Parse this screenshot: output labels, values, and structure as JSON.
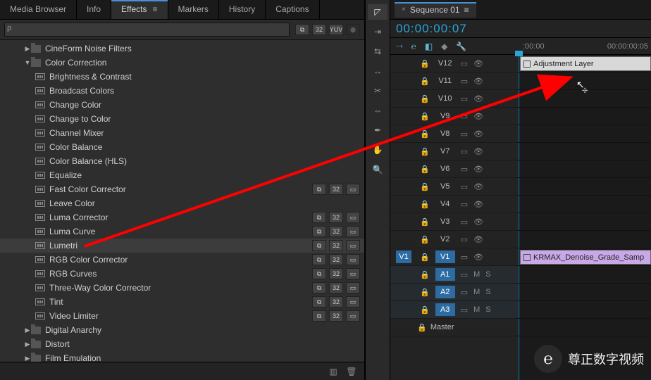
{
  "tabs": [
    "Media Browser",
    "Info",
    "Effects",
    "Markers",
    "History",
    "Captions"
  ],
  "active_tab": 2,
  "tab_menu_glyph": "≡",
  "search": {
    "placeholder": "",
    "value": ""
  },
  "search_icon_glyph": "ρ",
  "preset_icons": [
    {
      "name": "preset-icon",
      "glyph": "⧉"
    },
    {
      "name": "preset-32-icon",
      "glyph": "32"
    },
    {
      "name": "preset-yuv-icon",
      "glyph": "YUV"
    },
    {
      "name": "lumetri-scope-icon",
      "glyph": "◍"
    }
  ],
  "tree": [
    {
      "type": "folder",
      "level": 1,
      "expanded": false,
      "label": "CineForm Noise Filters"
    },
    {
      "type": "folder",
      "level": 1,
      "expanded": true,
      "label": "Color Correction"
    },
    {
      "type": "effect",
      "level": 2,
      "label": "Brightness & Contrast"
    },
    {
      "type": "effect",
      "level": 2,
      "label": "Broadcast Colors"
    },
    {
      "type": "effect",
      "level": 2,
      "label": "Change Color"
    },
    {
      "type": "effect",
      "level": 2,
      "label": "Change to Color"
    },
    {
      "type": "effect",
      "level": 2,
      "label": "Channel Mixer"
    },
    {
      "type": "effect",
      "level": 2,
      "label": "Color Balance"
    },
    {
      "type": "effect",
      "level": 2,
      "label": "Color Balance (HLS)"
    },
    {
      "type": "effect",
      "level": 2,
      "label": "Equalize"
    },
    {
      "type": "effect",
      "level": 2,
      "label": "Fast Color Corrector",
      "icons": true
    },
    {
      "type": "effect",
      "level": 2,
      "label": "Leave Color"
    },
    {
      "type": "effect",
      "level": 2,
      "label": "Luma Corrector",
      "icons": true
    },
    {
      "type": "effect",
      "level": 2,
      "label": "Luma Curve",
      "icons": true
    },
    {
      "type": "effect",
      "level": 2,
      "label": "Lumetri",
      "icons": true,
      "selected": true
    },
    {
      "type": "effect",
      "level": 2,
      "label": "RGB Color Corrector",
      "icons": true
    },
    {
      "type": "effect",
      "level": 2,
      "label": "RGB Curves",
      "icons": true
    },
    {
      "type": "effect",
      "level": 2,
      "label": "Three-Way Color Corrector",
      "icons": true
    },
    {
      "type": "effect",
      "level": 2,
      "label": "Tint",
      "icons": true
    },
    {
      "type": "effect",
      "level": 2,
      "label": "Video Limiter",
      "icons": true
    },
    {
      "type": "folder",
      "level": 1,
      "expanded": false,
      "label": "Digital Anarchy"
    },
    {
      "type": "folder",
      "level": 1,
      "expanded": false,
      "label": "Distort"
    },
    {
      "type": "folder",
      "level": 1,
      "expanded": false,
      "label": "Film Emulation"
    }
  ],
  "row_icon_glyphs": [
    "⧉",
    "32",
    "▭"
  ],
  "bottom_icons": [
    {
      "name": "new-bin-icon",
      "glyph": "▥"
    },
    {
      "name": "delete-icon",
      "glyph": "🗑"
    }
  ],
  "tools": [
    {
      "name": "selection-tool",
      "glyph": "◸",
      "active": true
    },
    {
      "name": "track-select-tool",
      "glyph": "⇥"
    },
    {
      "name": "ripple-edit-tool",
      "glyph": "⇆"
    },
    {
      "name": "rate-stretch-tool",
      "glyph": "↔"
    },
    {
      "name": "razor-tool",
      "glyph": "✂"
    },
    {
      "name": "slip-tool",
      "glyph": "⇔"
    },
    {
      "name": "pen-tool",
      "glyph": "✒"
    },
    {
      "name": "hand-tool",
      "glyph": "✋"
    },
    {
      "name": "zoom-tool",
      "glyph": "🔍"
    }
  ],
  "sequence": {
    "name": "Sequence 01",
    "timecode": "00:00:00:07"
  },
  "ruler": {
    "left": ":00:00",
    "right": "00:00:00:05"
  },
  "toolrow_icons": [
    {
      "name": "snap-icon",
      "glyph": "⤙",
      "color": "#5cbad6"
    },
    {
      "name": "linked-selection-icon",
      "glyph": "℮",
      "color": "#5cbad6"
    },
    {
      "name": "add-marker-icon",
      "glyph": "◧",
      "color": "#5cbad6"
    },
    {
      "name": "marker-icon",
      "glyph": "◆",
      "color": "#888"
    },
    {
      "name": "settings-icon",
      "glyph": "🔧",
      "color": "#888"
    }
  ],
  "video_tracks": [
    {
      "src": "",
      "name": "V12",
      "tgt": false
    },
    {
      "src": "",
      "name": "V11",
      "tgt": false
    },
    {
      "src": "",
      "name": "V10",
      "tgt": false
    },
    {
      "src": "",
      "name": "V9",
      "tgt": false
    },
    {
      "src": "",
      "name": "V8",
      "tgt": false
    },
    {
      "src": "",
      "name": "V7",
      "tgt": false
    },
    {
      "src": "",
      "name": "V6",
      "tgt": false
    },
    {
      "src": "",
      "name": "V5",
      "tgt": false
    },
    {
      "src": "",
      "name": "V4",
      "tgt": false
    },
    {
      "src": "",
      "name": "V3",
      "tgt": false
    },
    {
      "src": "",
      "name": "V2",
      "tgt": false
    },
    {
      "src": "V1",
      "name": "V1",
      "tgt": true
    }
  ],
  "audio_tracks": [
    {
      "src": "",
      "name": "A1",
      "tgt": true
    },
    {
      "src": "",
      "name": "A2",
      "tgt": true
    },
    {
      "src": "",
      "name": "A3",
      "tgt": true
    }
  ],
  "master_track": {
    "name": "Master"
  },
  "track_glyphs": {
    "lock": "🔒",
    "sync": "▭",
    "eye": "👁",
    "mute": "M",
    "solo": "S"
  },
  "clips": [
    {
      "track": 0,
      "label": "Adjustment Layer",
      "class": "adj"
    },
    {
      "track": 11,
      "label": "KRMAX_Denoise_Grade_Samp",
      "class": "purple"
    }
  ],
  "cursor_glyph": "↖",
  "watermark": {
    "icon": "℮",
    "text": "尊正数字视频"
  }
}
